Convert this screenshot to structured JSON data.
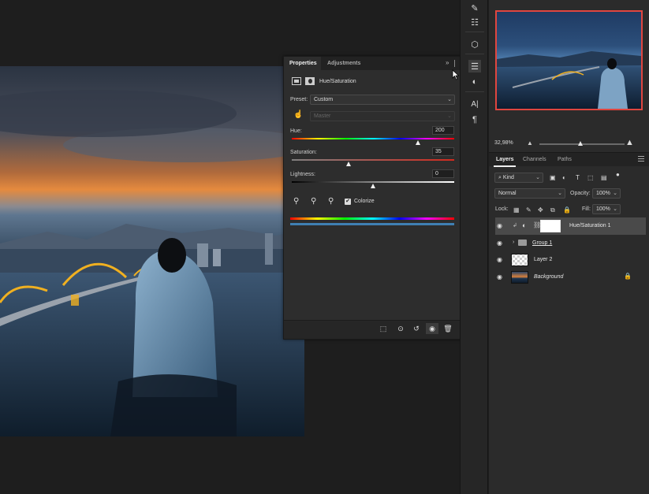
{
  "properties": {
    "tabs": [
      "Properties",
      "Adjustments"
    ],
    "collapse_glyph": "»",
    "adjustment_name": "Hue/Saturation",
    "preset_label": "Preset:",
    "preset_value": "Custom",
    "channel_value": "Master",
    "hue_label": "Hue:",
    "hue_value": "200",
    "hue_fraction": 0.778,
    "saturation_label": "Saturation:",
    "saturation_value": "35",
    "saturation_fraction": 0.35,
    "lightness_label": "Lightness:",
    "lightness_value": "0",
    "lightness_fraction": 0.5,
    "colorize_label": "Colorize",
    "colorize_checked": true,
    "colorize_check": "✔"
  },
  "navigator": {
    "zoom_value": "32,98%",
    "zoom_fraction": 0.48
  },
  "layers": {
    "tabs": [
      "Layers",
      "Channels",
      "Paths"
    ],
    "filter_kind": "Kind",
    "blend_mode": "Normal",
    "opacity_label": "Opacity:",
    "opacity_value": "100%",
    "lock_label": "Lock:",
    "fill_label": "Fill:",
    "fill_value": "100%",
    "items": [
      {
        "name": "Hue/Saturation 1",
        "selected": true
      },
      {
        "name": "Group 1",
        "selected": false
      },
      {
        "name": "Layer 2",
        "selected": false
      },
      {
        "name": "Background",
        "selected": false
      }
    ]
  },
  "icons": {
    "eye": "eye-icon",
    "lock": "lock-icon",
    "folder": "folder-icon",
    "eyedropper": "eyedropper-icon",
    "mask": "mask-icon",
    "hand": "hand-target-icon"
  },
  "colors": {
    "selection_border": "#e0463f",
    "panel_bg": "#2d2d2d",
    "dock_bg": "#2b2b2b"
  }
}
